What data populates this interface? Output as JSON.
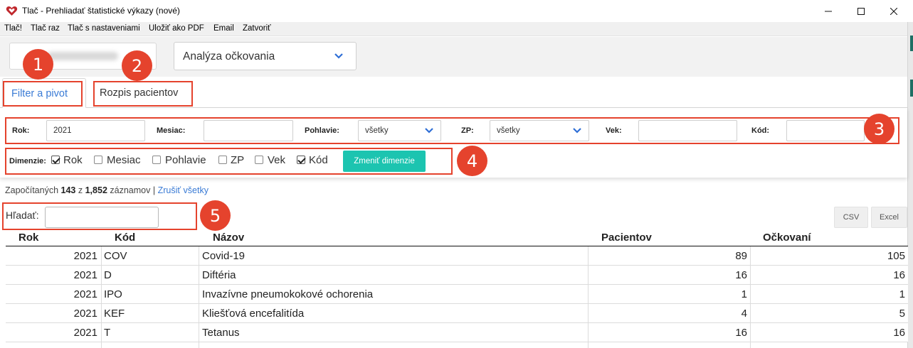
{
  "window": {
    "title": "Tlač - Prehliadať štatistické výkazy (nové)",
    "controls": {
      "minimize": "–",
      "maximize": "☐",
      "close": "✕"
    }
  },
  "menu": {
    "items": [
      "Tlač!",
      "Tlač raz",
      "Tlač s nastaveniami",
      "Uložiť ako PDF",
      "Email",
      "Zatvoriť"
    ]
  },
  "report_select": {
    "value": "Analýza očkovania"
  },
  "tabs": [
    {
      "label": "Filter a pivot",
      "active": true
    },
    {
      "label": "Rozpis pacientov",
      "active": false
    }
  ],
  "filters": {
    "rok": {
      "label": "Rok:",
      "value": "2021"
    },
    "mesiac": {
      "label": "Mesiac:",
      "value": ""
    },
    "pohlavie": {
      "label": "Pohlavie:",
      "value": "všetky"
    },
    "zp": {
      "label": "ZP:",
      "value": "všetky"
    },
    "vek": {
      "label": "Vek:",
      "value": ""
    },
    "kod": {
      "label": "Kód:",
      "value": ""
    }
  },
  "dimensions": {
    "label": "Dimenzie:",
    "items": [
      {
        "label": "Rok",
        "checked": true
      },
      {
        "label": "Mesiac",
        "checked": false
      },
      {
        "label": "Pohlavie",
        "checked": false
      },
      {
        "label": "ZP",
        "checked": false
      },
      {
        "label": "Vek",
        "checked": false
      },
      {
        "label": "Kód",
        "checked": true
      }
    ],
    "button": "Zmeniť dimenzie"
  },
  "counter": {
    "prefix": "Započítaných",
    "count": "143",
    "of": "z",
    "total": "1,852",
    "suffix": "záznamov",
    "sep": "|",
    "clear_link": "Zrušiť všetky"
  },
  "search": {
    "label": "Hľadať:",
    "value": ""
  },
  "export": {
    "csv": "CSV",
    "excel": "Excel"
  },
  "annotations": [
    "1",
    "2",
    "3",
    "4",
    "5"
  ],
  "table": {
    "columns": [
      "Rok",
      "Kód",
      "Názov",
      "Pacientov",
      "Očkovaní"
    ],
    "rows": [
      [
        "2021",
        "COV",
        "Covid-19",
        "89",
        "105"
      ],
      [
        "2021",
        "D",
        "Diftéria",
        "16",
        "16"
      ],
      [
        "2021",
        "IPO",
        "Invazívne pneumokokové ochorenia",
        "1",
        "1"
      ],
      [
        "2021",
        "KEF",
        "Kliešťová encefalitída",
        "4",
        "5"
      ],
      [
        "2021",
        "T",
        "Tetanus",
        "16",
        "16"
      ]
    ]
  },
  "colors": {
    "accent_red": "#e5432d",
    "teal_button": "#1cc4b0",
    "link_blue": "#3a7bd5",
    "app_icon_red": "#c0282d"
  }
}
